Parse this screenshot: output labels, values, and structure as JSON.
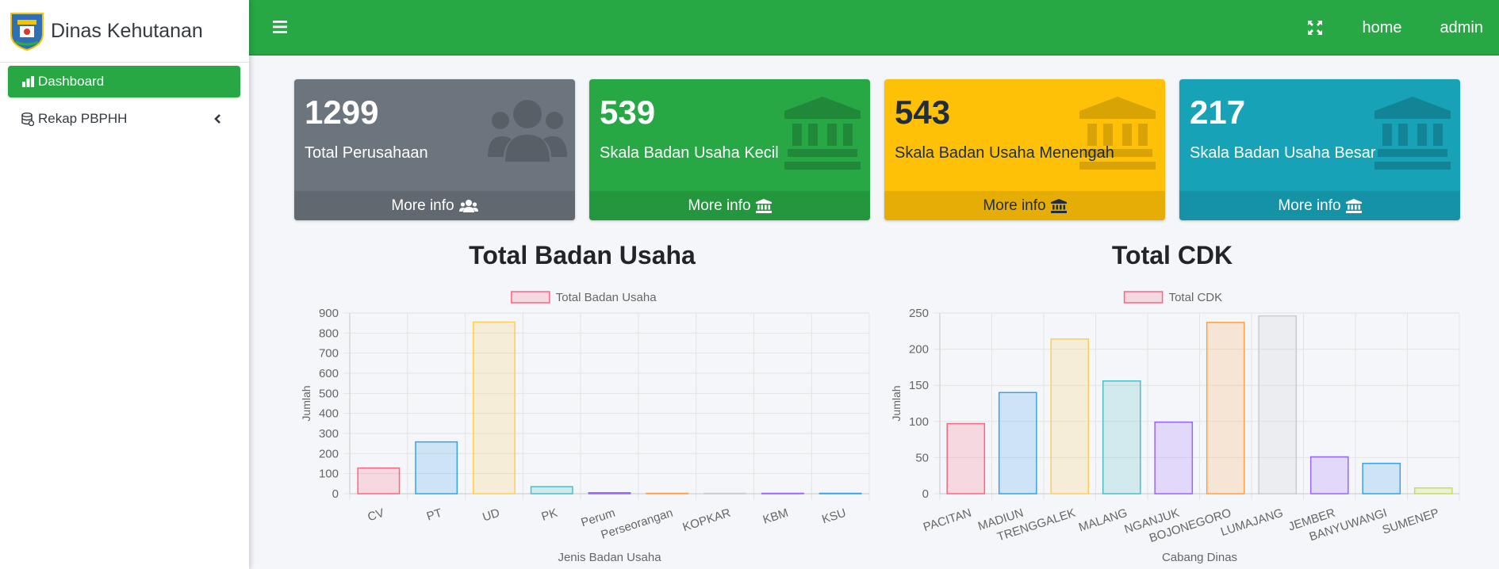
{
  "sidebar": {
    "brand": "Dinas Kehutanan",
    "items": [
      {
        "label": "Dashboard",
        "icon": "bar-chart-icon",
        "active": true
      },
      {
        "label": "Rekap PBPHH",
        "icon": "database-icon",
        "active": false
      }
    ]
  },
  "topbar": {
    "menu_icon": "bars-icon",
    "fullscreen_icon": "expand-icon",
    "links": [
      "home",
      "admin"
    ]
  },
  "info_boxes": [
    {
      "number": "1299",
      "label": "Total Perusahaan",
      "footer": "More info",
      "icon": "users-icon",
      "color": "#6c757d"
    },
    {
      "number": "539",
      "label": "Skala Badan Usaha Kecil",
      "footer": "More info",
      "icon": "landmark-icon",
      "color": "#28a745"
    },
    {
      "number": "543",
      "label": "Skala Badan Usaha Menengah",
      "footer": "More info",
      "icon": "landmark-icon",
      "color": "#ffc107"
    },
    {
      "number": "217",
      "label": "Skala Badan Usaha Besar",
      "footer": "More info",
      "icon": "landmark-icon",
      "color": "#17a2b8"
    }
  ],
  "chart_data": [
    {
      "type": "bar",
      "title": "Total Badan Usaha",
      "legend": "Total Badan Usaha",
      "xlabel": "Jenis Badan Usaha",
      "ylabel": "Jumlah",
      "categories": [
        "CV",
        "PT",
        "UD",
        "PK",
        "Perum",
        "Perseorangan",
        "KOPKAR",
        "KBM",
        "KSU"
      ],
      "values": [
        128,
        258,
        855,
        35,
        5,
        2,
        0,
        2,
        0
      ],
      "ylim": [
        0,
        900
      ],
      "yticks": [
        0,
        100,
        200,
        300,
        400,
        500,
        600,
        700,
        800,
        900
      ],
      "grid": true,
      "legend_position": "top"
    },
    {
      "type": "bar",
      "title": "Total CDK",
      "legend": "Total CDK",
      "xlabel": "Cabang Dinas",
      "ylabel": "Jumlah",
      "categories": [
        "PACITAN",
        "MADIUN",
        "TRENGGALEK",
        "MALANG",
        "NGANJUK",
        "BOJONEGORO",
        "LUMAJANG",
        "JEMBER",
        "BANYUWANGI",
        "SUMENEP"
      ],
      "values": [
        97,
        140,
        214,
        156,
        99,
        237,
        246,
        51,
        42,
        8
      ],
      "ylim": [
        0,
        250
      ],
      "yticks": [
        0,
        50,
        100,
        150,
        200,
        250
      ],
      "grid": true,
      "legend_position": "top"
    }
  ],
  "bar_colors": {
    "fills": [
      "#ff638433",
      "#36a2eb33",
      "#ffcd5633",
      "#4bc0c033",
      "#9966ff33",
      "#ff9f4033",
      "#c9cbcf33",
      "#9966ff33",
      "#36a2eb33",
      "#c3e15533"
    ],
    "strokes": [
      "#ff6384",
      "#36a2eb",
      "#ffcd56",
      "#4bc0c0",
      "#9966ff",
      "#ff9f40",
      "#c9cbcf",
      "#9966ff",
      "#36a2eb",
      "#c3e155"
    ]
  }
}
